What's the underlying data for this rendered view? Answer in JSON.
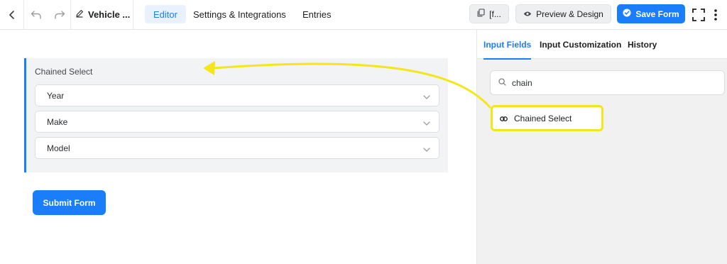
{
  "toolbar": {
    "back_icon": "chevron-left-icon",
    "undo_icon": "undo-icon",
    "redo_icon": "redo-icon",
    "edit_icon": "pencil-icon",
    "form_title": "Vehicle ...",
    "tabs": [
      {
        "label": "Editor",
        "active": true
      },
      {
        "label": "Settings & Integrations",
        "active": false
      },
      {
        "label": "Entries",
        "active": false
      }
    ],
    "shortcode_label": "[f...",
    "preview_label": "Preview & Design",
    "save_label": "Save Form",
    "accent_color": "#1a7efb"
  },
  "canvas": {
    "field_label": "Chained Select",
    "selects": [
      {
        "placeholder": "Year"
      },
      {
        "placeholder": "Make"
      },
      {
        "placeholder": "Model"
      }
    ],
    "submit_label": "Submit Form"
  },
  "panel": {
    "tabs": [
      {
        "label": "Input Fields",
        "active": true
      },
      {
        "label": "Input Customization",
        "active": false
      },
      {
        "label": "History",
        "active": false
      }
    ],
    "search_value": "chain",
    "result_label": "Chained Select",
    "highlight_color": "#f5e51b"
  }
}
